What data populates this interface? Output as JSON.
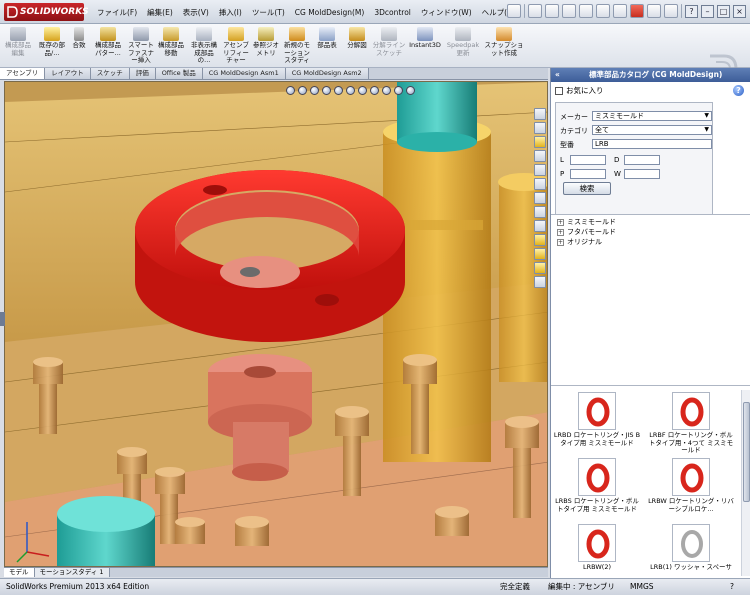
{
  "app": {
    "logo": "SOLIDWORKS"
  },
  "menus": [
    "ファイル(F)",
    "編集(E)",
    "表示(V)",
    "挿入(I)",
    "ツール(T)",
    "CG MoldDesign(M)",
    "3Dcontrol",
    "ウィンドウ(W)",
    "ヘルプ(H)"
  ],
  "commands": [
    {
      "label": "構成部品編集",
      "icon": "edit-component-icon"
    },
    {
      "label": "既存の部品/...",
      "icon": "insert-component-icon"
    },
    {
      "label": "合致",
      "icon": "mate-icon"
    },
    {
      "label": "構成部品パター...",
      "icon": "component-pattern-icon"
    },
    {
      "label": "スマートファスナー挿入",
      "icon": "smart-fastener-icon"
    },
    {
      "label": "構成部品移動",
      "icon": "move-component-icon"
    },
    {
      "label": "非表示構成部品の...",
      "icon": "hide-component-icon"
    },
    {
      "label": "アセンブリフィーチャー",
      "icon": "assembly-feature-icon"
    },
    {
      "label": "参照ジオメトリ",
      "icon": "reference-geometry-icon"
    },
    {
      "label": "新規のモーションスタディ",
      "icon": "motion-study-icon"
    },
    {
      "label": "部品表",
      "icon": "bom-icon"
    },
    {
      "label": "分解図",
      "icon": "exploded-view-icon"
    },
    {
      "label": "分解ラインスケッチ",
      "icon": "explode-line-icon"
    },
    {
      "label": "Instant3D",
      "icon": "instant3d-icon"
    },
    {
      "label": "Speedpak更新",
      "icon": "speedpak-icon"
    },
    {
      "label": "スナップショット作成",
      "icon": "snapshot-icon"
    }
  ],
  "tabs": [
    "アセンブリ",
    "レイアウト",
    "スケッチ",
    "評価",
    "Office 製品",
    "CG MoldDesign Asm1",
    "CG MoldDesign Asm2"
  ],
  "model_tabs": [
    "モデル",
    "モーションスタディ 1"
  ],
  "status": {
    "edition": "SolidWorks Premium 2013 x64 Edition",
    "state": "完全定義",
    "editing": "編集中 : アセンブリ",
    "units": "MMGS",
    "help": "?"
  },
  "taskpane": {
    "collapse": "«",
    "title": "標準部品カタログ (CG MoldDesign)",
    "favorites_label": "お気に入り",
    "maker_label": "メーカー",
    "maker_value": "ミスミモールド",
    "category_label": "カテゴリ",
    "category_value": "全て",
    "model_label": "型番",
    "model_value": "LRB",
    "param_l": "L",
    "param_d": "D",
    "param_p": "P",
    "param_w": "W",
    "search_button": "検索",
    "tree": [
      "ミスミモールド",
      "フタバモールド",
      "オリジナル"
    ],
    "results": [
      {
        "label": "LRBD ロケートリング・JIS B タイプ用 ミスミモールド",
        "color": "#d8261c"
      },
      {
        "label": "LRBF ロケートリング・ボルトタイプ用・4つて ミスミモールド",
        "color": "#d8261c"
      },
      {
        "label": "LRBS ロケートリング・ボルトタイプ用 ミスミモールド",
        "color": "#d8261c"
      },
      {
        "label": "LRBW ロケートリング・リバーシブルロケ...",
        "color": "#d8261c"
      },
      {
        "label": "LRBW(2)",
        "color": "#d8261c"
      },
      {
        "label": "LRB(1) ワッシャ・スペーサ",
        "color": "#a8a8a8"
      }
    ]
  }
}
